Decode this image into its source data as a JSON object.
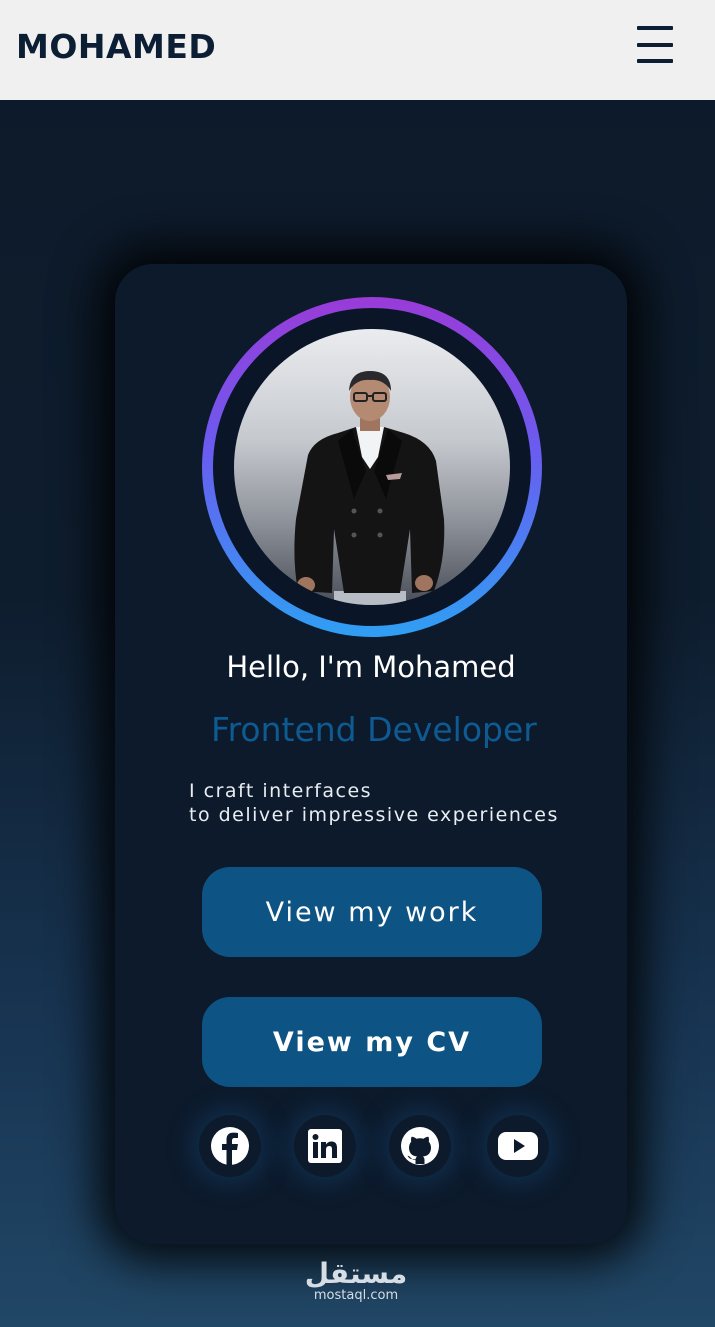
{
  "navbar": {
    "brand": "MOHAMED",
    "menu_icon": "hamburger-menu-icon"
  },
  "profile": {
    "greeting": "Hello, I'm Mohamed",
    "role": "Frontend Developer",
    "description_line1": "I craft interfaces",
    "description_line2": "to deliver impressive experiences",
    "ring_gradient": [
      "#9a3bd8",
      "#6a5cf0",
      "#2f9ff3"
    ]
  },
  "buttons": {
    "work_label": "View my work",
    "cv_label": "View my CV"
  },
  "social": [
    {
      "icon": "facebook-icon"
    },
    {
      "icon": "linkedin-icon"
    },
    {
      "icon": "github-icon"
    },
    {
      "icon": "youtube-icon"
    }
  ],
  "watermark": {
    "arabic": "مستقل",
    "latin": "mostaql.com"
  },
  "colors": {
    "navbar_bg": "#f0f0f0",
    "brand": "#0b1e33",
    "card_bg": "#0c1a2b",
    "button_bg": "#0d5383",
    "role_text": "#0e5a92"
  }
}
